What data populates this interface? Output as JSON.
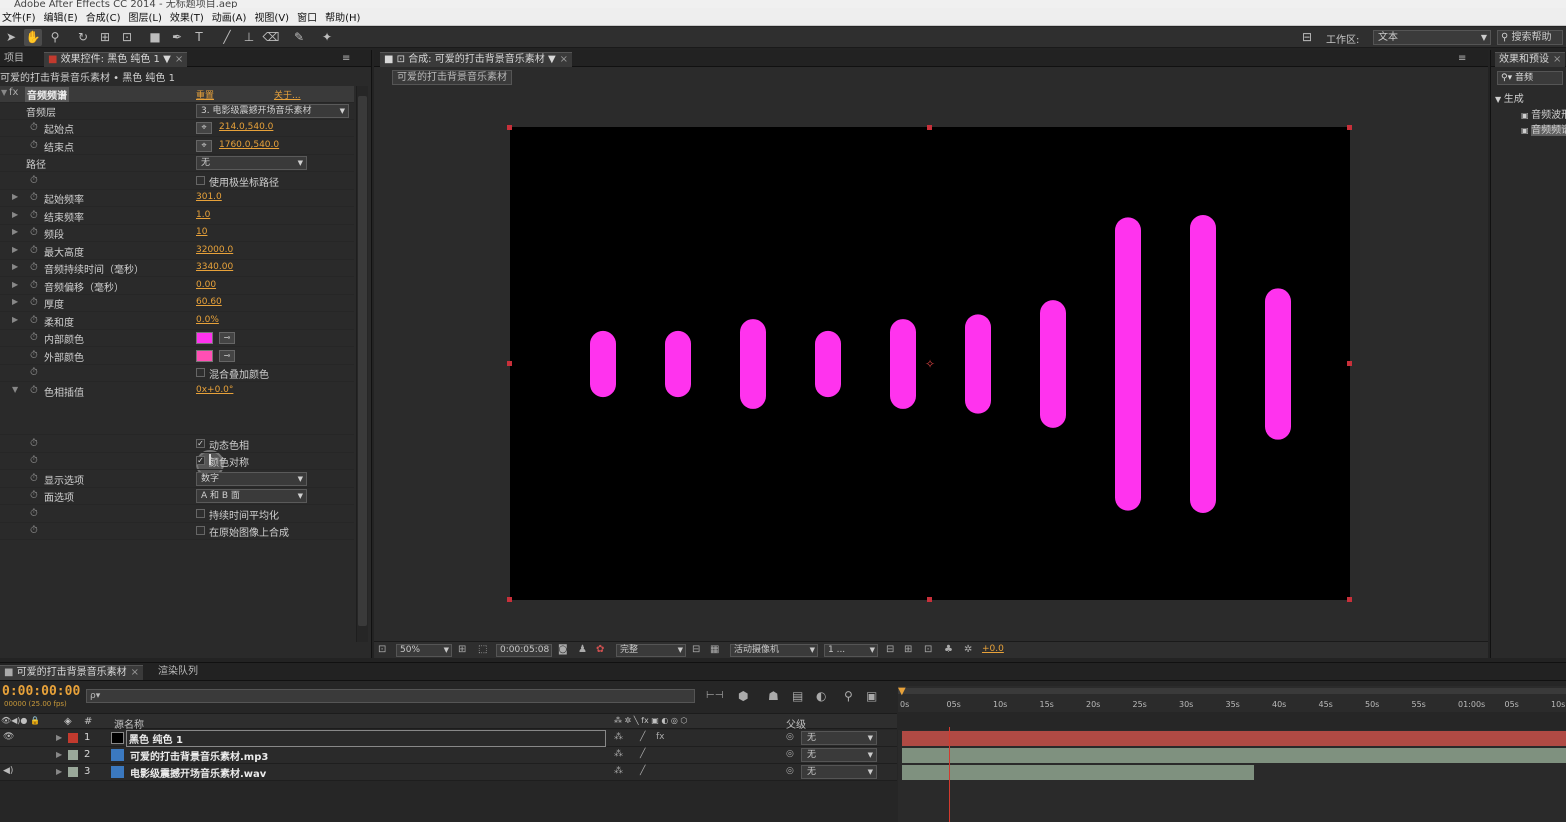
{
  "app": {
    "title": "Adobe After Effects CC 2014 - 无标题项目.aep"
  },
  "menu": [
    "文件(F)",
    "编辑(E)",
    "合成(C)",
    "图层(L)",
    "效果(T)",
    "动画(A)",
    "视图(V)",
    "窗口",
    "帮助(H)"
  ],
  "toolbar": {
    "workspace_label": "工作区:",
    "workspace_value": "文本",
    "help_search": "搜索帮助"
  },
  "effect_controls": {
    "tab_project": "项目",
    "tab_label": "效果控件: 黑色 纯色 1",
    "breadcrumb": "可爱的打击背景音乐素材 • 黑色 纯色 1",
    "effect_name": "音频频谱",
    "reset": "重置",
    "about": "关于...",
    "rows": {
      "audio_layer": {
        "label": "音频层",
        "value": "3. 电影级震撼开场音乐素材"
      },
      "start_point": {
        "label": "起始点",
        "value": "214.0,540.0"
      },
      "end_point": {
        "label": "结束点",
        "value": "1760.0,540.0"
      },
      "path": {
        "label": "路径",
        "value": "无"
      },
      "use_polar": {
        "label": "使用极坐标路径",
        "checked": false
      },
      "start_freq": {
        "label": "起始频率",
        "value": "301.0"
      },
      "end_freq": {
        "label": "结束频率",
        "value": "1.0"
      },
      "bands": {
        "label": "频段",
        "value": "10"
      },
      "max_height": {
        "label": "最大高度",
        "value": "32000.0"
      },
      "audio_duration": {
        "label": "音频持续时间（毫秒）",
        "value": "3340.00"
      },
      "audio_offset": {
        "label": "音频偏移（毫秒）",
        "value": "0.00"
      },
      "thickness": {
        "label": "厚度",
        "value": "60.60"
      },
      "softness": {
        "label": "柔和度",
        "value": "0.0%"
      },
      "inside_color": {
        "label": "内部颜色",
        "color": "#ff33ee"
      },
      "outside_color": {
        "label": "外部颜色",
        "color": "#ff4fb4"
      },
      "blend_overlap": {
        "label": "混合叠加颜色",
        "checked": false
      },
      "hue_interp": {
        "label": "色相插值",
        "value": "0x+0.0°"
      },
      "dynamic_hue": {
        "label": "动态色相",
        "checked": true
      },
      "color_symmetry": {
        "label": "颜色对称",
        "checked": true
      },
      "display_options": {
        "label": "显示选项",
        "value": "数字"
      },
      "side_options": {
        "label": "面选项",
        "value": "A 和 B 面"
      },
      "duration_avg": {
        "label": "持续时间平均化",
        "checked": false
      },
      "composite_original": {
        "label": "在原始图像上合成",
        "checked": false
      }
    }
  },
  "composition": {
    "tab_label": "合成: 可爱的打击背景音乐素材",
    "sub_tab": "可爱的打击背景音乐素材",
    "spectrum_bars": [
      {
        "height": 0.14
      },
      {
        "height": 0.14
      },
      {
        "height": 0.19
      },
      {
        "height": 0.14
      },
      {
        "height": 0.19
      },
      {
        "height": 0.21
      },
      {
        "height": 0.27
      },
      {
        "height": 0.62
      },
      {
        "height": 0.63
      },
      {
        "height": 0.32
      }
    ],
    "bar_color": "#ff33ee",
    "footer": {
      "zoom": "50%",
      "timecode": "0:00:05:08",
      "quality": "完整",
      "camera": "活动摄像机",
      "views": "1 ...",
      "exposure": "+0.0"
    }
  },
  "effects_panel": {
    "tab_label": "效果和预设",
    "search": "音频",
    "category": "生成",
    "items": [
      "音频波形",
      "音频频谱"
    ]
  },
  "timeline": {
    "tab_comp": "可爱的打击背景音乐素材",
    "tab_render": "渲染队列",
    "timecode": "0:00:00:00",
    "timecode_sub": "00000 (25.00 fps)",
    "search_placeholder": "ρ▾",
    "col_name": "源名称",
    "col_parent": "父级",
    "col_num": "#",
    "ruler": [
      "0s",
      "05s",
      "10s",
      "15s",
      "20s",
      "25s",
      "30s",
      "35s",
      "40s",
      "45s",
      "50s",
      "55s",
      "01:00s",
      "05s",
      "10s"
    ],
    "layers": [
      {
        "num": "1",
        "name": "黑色 纯色 1",
        "label_color": "#c23a2e",
        "parent": "无",
        "bar_color": "#b04a44",
        "bar_end": 1.0
      },
      {
        "num": "2",
        "name": "可爱的打击背景音乐素材.mp3",
        "label_color": "#9aa89a",
        "parent": "无",
        "bar_color": "#7f917f",
        "bar_end": 1.0
      },
      {
        "num": "3",
        "name": "电影级震撼开场音乐素材.wav",
        "label_color": "#9aa89a",
        "parent": "无",
        "bar_color": "#7f917f",
        "bar_end": 0.53
      }
    ]
  }
}
